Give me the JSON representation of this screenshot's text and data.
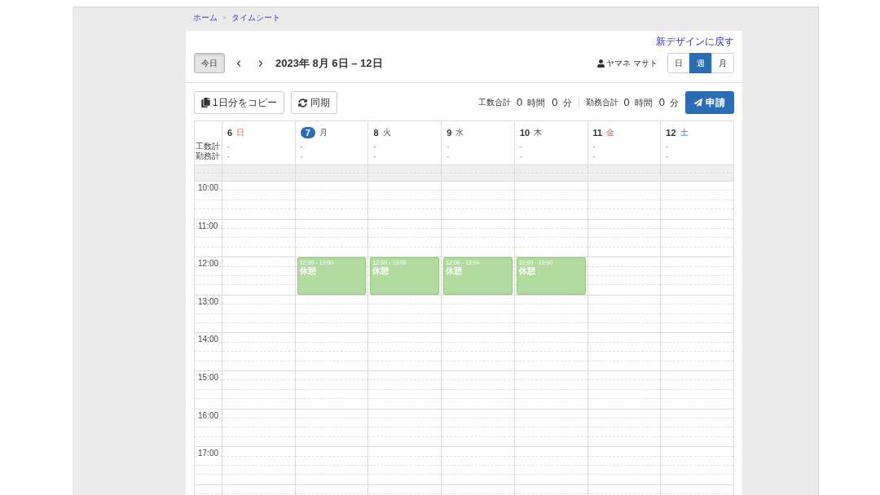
{
  "breadcrumb": {
    "items": [
      "ホーム",
      "タイムシート"
    ],
    "separator": ">"
  },
  "header": {
    "switch_link": "新デザインに戻す",
    "today_button": "今日",
    "range_title": "2023年 8月 6日 – 12日",
    "user": "ヤマネ マサト",
    "views": [
      {
        "label": "日",
        "selected": false
      },
      {
        "label": "週",
        "selected": true
      },
      {
        "label": "月",
        "selected": false
      }
    ]
  },
  "toolbar": {
    "copy_button": "1日分をコピー",
    "sync_button": "同期",
    "totals": [
      {
        "label": "工数合計",
        "hours": "0",
        "hours_unit": "時間",
        "minutes": "0",
        "minutes_unit": "分"
      },
      {
        "label": "勤務合計",
        "hours": "0",
        "hours_unit": "時間",
        "minutes": "0",
        "minutes_unit": "分"
      }
    ],
    "submit_button": "申請"
  },
  "calendar": {
    "summary_labels": [
      "工数計",
      "勤務計"
    ],
    "days": [
      {
        "date": "6",
        "weekday": "日",
        "kind": "sunday",
        "today": false,
        "summary": [
          "-",
          "-"
        ]
      },
      {
        "date": "7",
        "weekday": "月",
        "kind": "weekday",
        "today": true,
        "summary": [
          "-",
          "-"
        ],
        "events": [
          {
            "time": "12:00 - 13:00",
            "title": "休憩"
          }
        ]
      },
      {
        "date": "8",
        "weekday": "火",
        "kind": "weekday",
        "today": false,
        "summary": [
          "-",
          "-"
        ],
        "events": [
          {
            "time": "12:00 - 13:00",
            "title": "休憩"
          }
        ]
      },
      {
        "date": "9",
        "weekday": "水",
        "kind": "weekday",
        "today": false,
        "summary": [
          "-",
          "-"
        ],
        "events": [
          {
            "time": "12:00 - 13:00",
            "title": "休憩"
          }
        ]
      },
      {
        "date": "10",
        "weekday": "木",
        "kind": "weekday",
        "today": false,
        "summary": [
          "-",
          "-"
        ],
        "events": [
          {
            "time": "12:00 - 13:00",
            "title": "休憩"
          }
        ]
      },
      {
        "date": "11",
        "weekday": "金",
        "kind": "holiday",
        "today": false,
        "summary": [
          "-",
          "-"
        ]
      },
      {
        "date": "12",
        "weekday": "土",
        "kind": "saturday",
        "today": false,
        "summary": [
          "-",
          "-"
        ]
      }
    ],
    "hours": [
      "10:00",
      "11:00",
      "12:00",
      "13:00",
      "14:00",
      "15:00",
      "16:00",
      "17:00"
    ]
  }
}
